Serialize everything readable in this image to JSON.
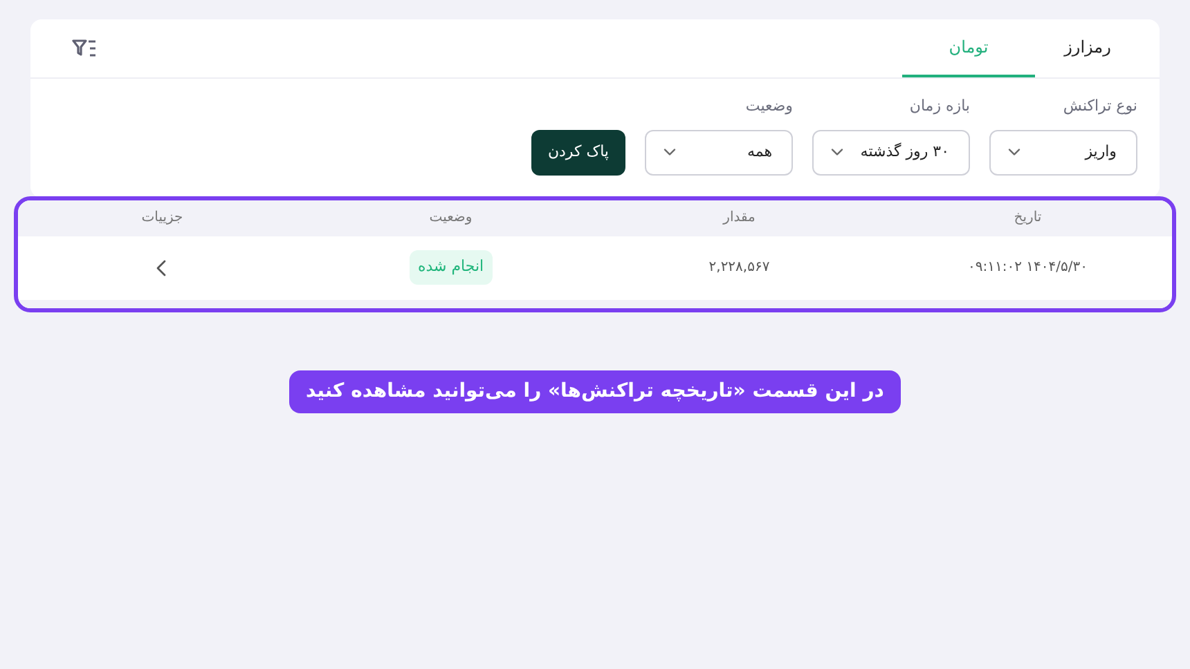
{
  "tabs": [
    {
      "label": "رمزارز",
      "selected": false
    },
    {
      "label": "تومان",
      "selected": true
    }
  ],
  "filters": [
    {
      "label": "نوع تراکنش",
      "value": "واریز"
    },
    {
      "label": "بازه زمان",
      "value": "۳۰ روز گذشته"
    },
    {
      "label": "وضعیت",
      "value": "همه"
    }
  ],
  "clear_button": "پاک کردن",
  "table": {
    "columns": [
      "تاریخ",
      "مقدار",
      "وضعیت",
      "جزییات"
    ],
    "rows": [
      {
        "date": "۱۴۰۴/۵/۳۰ ۰۹:۱۱:۰۲",
        "amount": "۲,۲۲۸,۵۶۷",
        "status": "انجام شده"
      }
    ]
  },
  "caption": "در این قسمت «تاریخچه تراکنش‌ها» را می‌توانید مشاهده کنید"
}
